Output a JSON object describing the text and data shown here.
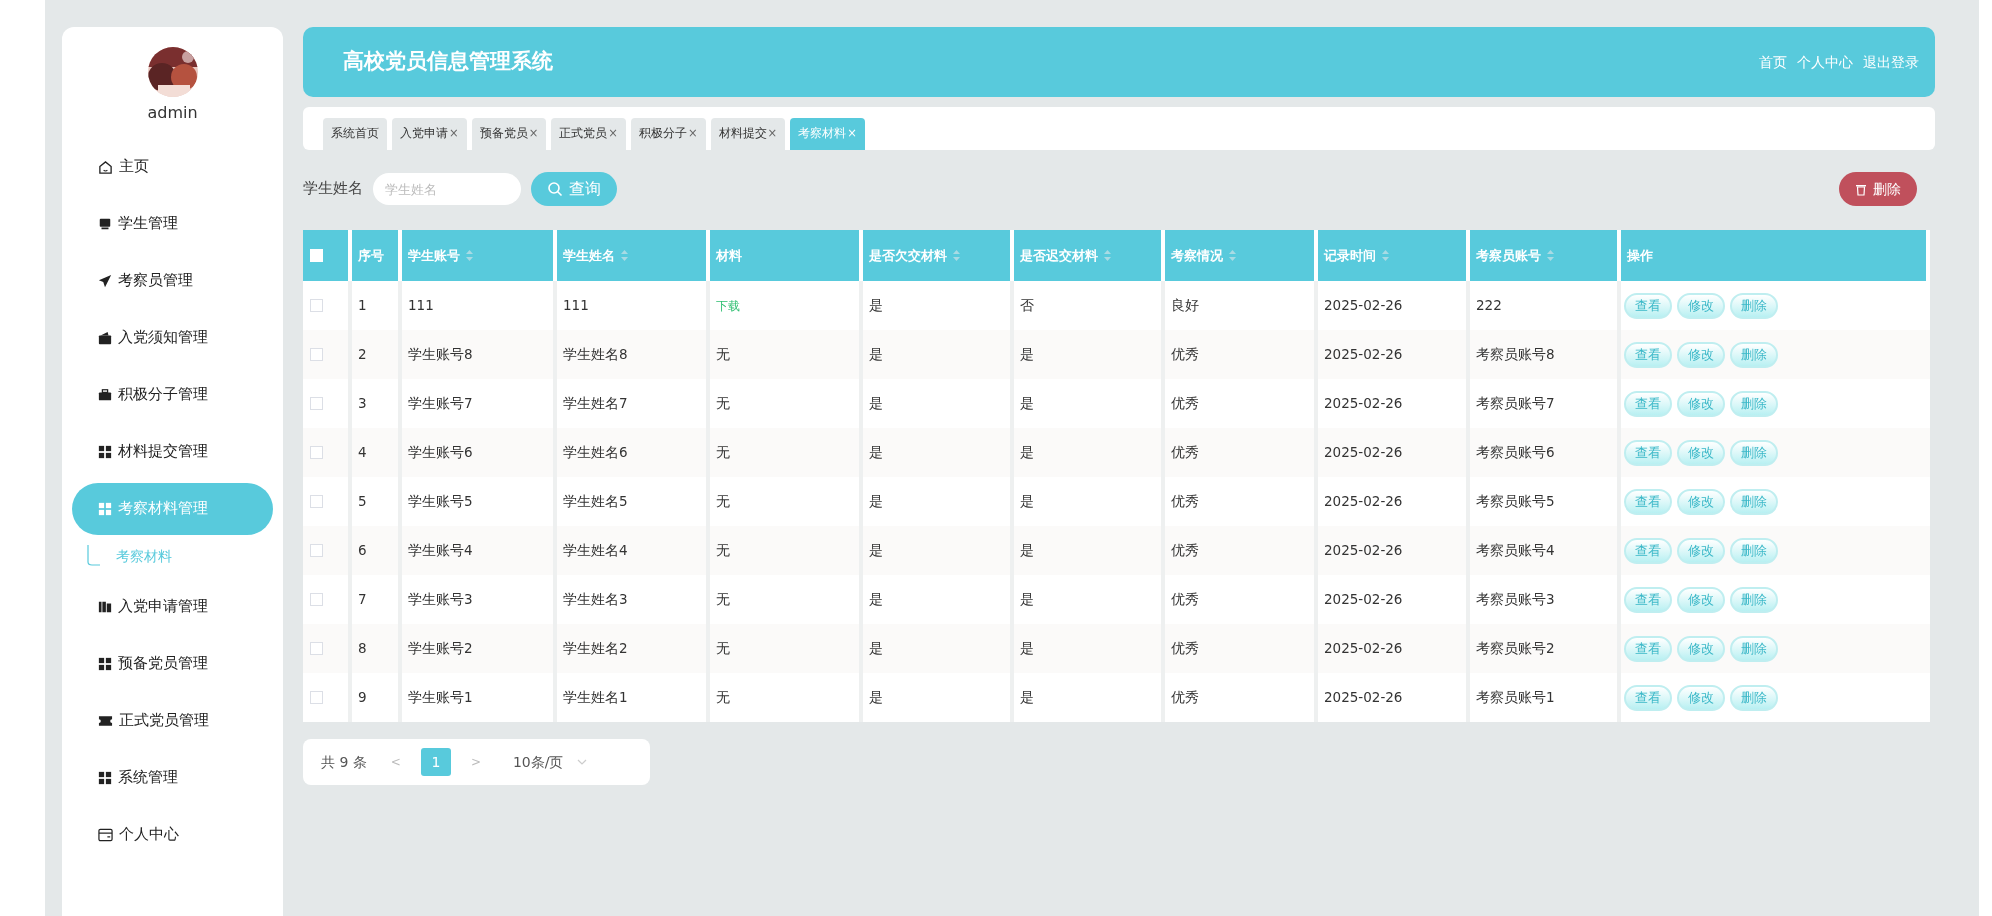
{
  "sidebar": {
    "user": "admin",
    "items": [
      {
        "label": "主页",
        "selected": false
      },
      {
        "label": "学生管理",
        "selected": false
      },
      {
        "label": "考察员管理",
        "selected": false
      },
      {
        "label": "入党须知管理",
        "selected": false
      },
      {
        "label": "积极分子管理",
        "selected": false
      },
      {
        "label": "材料提交管理",
        "selected": false
      },
      {
        "label": "考察材料管理",
        "selected": true,
        "children": [
          {
            "label": "考察材料",
            "selected": true
          }
        ]
      },
      {
        "label": "入党申请管理",
        "selected": false
      },
      {
        "label": "预备党员管理",
        "selected": false
      },
      {
        "label": "正式党员管理",
        "selected": false
      },
      {
        "label": "系统管理",
        "selected": false
      },
      {
        "label": "个人中心",
        "selected": false
      }
    ]
  },
  "header": {
    "title": "高校党员信息管理系统",
    "links": [
      "首页",
      "个人中心",
      "退出登录"
    ]
  },
  "tabs": [
    {
      "label": "系统首页",
      "selected": false
    },
    {
      "label": "入党申请",
      "close": "×",
      "selected": false
    },
    {
      "label": "预备党员",
      "close": "×",
      "selected": false
    },
    {
      "label": "正式党员",
      "close": "×",
      "selected": false
    },
    {
      "label": "积极分子",
      "close": "×",
      "selected": false
    },
    {
      "label": "材料提交",
      "close": "×",
      "selected": false
    },
    {
      "label": "考察材料",
      "close": "×",
      "selected": true
    }
  ],
  "search": {
    "label": "学生姓名",
    "placeholder": "学生姓名",
    "button": "查询",
    "delete_button": "删除"
  },
  "table": {
    "select_all": {
      "checked": false
    },
    "columns": [
      {
        "label": "序号",
        "sortable": false
      },
      {
        "label": "学生账号",
        "sortable": true
      },
      {
        "label": "学生姓名",
        "sortable": true
      },
      {
        "label": "材料",
        "sortable": false
      },
      {
        "label": "是否欠交材料",
        "sortable": true
      },
      {
        "label": "是否迟交材料",
        "sortable": true
      },
      {
        "label": "考察情况",
        "sortable": true
      },
      {
        "label": "记录时间",
        "sortable": true
      },
      {
        "label": "考察员账号",
        "sortable": true
      },
      {
        "label": "操作",
        "sortable": false
      }
    ],
    "rows": [
      {
        "checked": false,
        "cells": [
          "1",
          "111",
          "111",
          {
            "text": "下载",
            "kind": "link"
          },
          "是",
          "否",
          "良好",
          "2025-02-26",
          "222"
        ],
        "actions": [
          "查看",
          "修改",
          "删除"
        ]
      },
      {
        "checked": false,
        "cells": [
          "2",
          "学生账号8",
          "学生姓名8",
          {
            "text": "无",
            "kind": "text"
          },
          "是",
          "是",
          "优秀",
          "2025-02-26",
          "考察员账号8"
        ],
        "actions": [
          "查看",
          "修改",
          "删除"
        ]
      },
      {
        "checked": false,
        "cells": [
          "3",
          "学生账号7",
          "学生姓名7",
          {
            "text": "无",
            "kind": "text"
          },
          "是",
          "是",
          "优秀",
          "2025-02-26",
          "考察员账号7"
        ],
        "actions": [
          "查看",
          "修改",
          "删除"
        ]
      },
      {
        "checked": false,
        "cells": [
          "4",
          "学生账号6",
          "学生姓名6",
          {
            "text": "无",
            "kind": "text"
          },
          "是",
          "是",
          "优秀",
          "2025-02-26",
          "考察员账号6"
        ],
        "actions": [
          "查看",
          "修改",
          "删除"
        ]
      },
      {
        "checked": false,
        "cells": [
          "5",
          "学生账号5",
          "学生姓名5",
          {
            "text": "无",
            "kind": "text"
          },
          "是",
          "是",
          "优秀",
          "2025-02-26",
          "考察员账号5"
        ],
        "actions": [
          "查看",
          "修改",
          "删除"
        ]
      },
      {
        "checked": false,
        "cells": [
          "6",
          "学生账号4",
          "学生姓名4",
          {
            "text": "无",
            "kind": "text"
          },
          "是",
          "是",
          "优秀",
          "2025-02-26",
          "考察员账号4"
        ],
        "actions": [
          "查看",
          "修改",
          "删除"
        ]
      },
      {
        "checked": false,
        "cells": [
          "7",
          "学生账号3",
          "学生姓名3",
          {
            "text": "无",
            "kind": "text"
          },
          "是",
          "是",
          "优秀",
          "2025-02-26",
          "考察员账号3"
        ],
        "actions": [
          "查看",
          "修改",
          "删除"
        ]
      },
      {
        "checked": false,
        "cells": [
          "8",
          "学生账号2",
          "学生姓名2",
          {
            "text": "无",
            "kind": "text"
          },
          "是",
          "是",
          "优秀",
          "2025-02-26",
          "考察员账号2"
        ],
        "actions": [
          "查看",
          "修改",
          "删除"
        ]
      },
      {
        "checked": false,
        "cells": [
          "9",
          "学生账号1",
          "学生姓名1",
          {
            "text": "无",
            "kind": "text"
          },
          "是",
          "是",
          "优秀",
          "2025-02-26",
          "考察员账号1"
        ],
        "actions": [
          "查看",
          "修改",
          "删除"
        ]
      }
    ]
  },
  "pagination": {
    "total": "共 9 条",
    "prev": "<",
    "pages": [
      {
        "label": "1",
        "selected": true
      }
    ],
    "next": ">",
    "page_size": "10条/页"
  }
}
